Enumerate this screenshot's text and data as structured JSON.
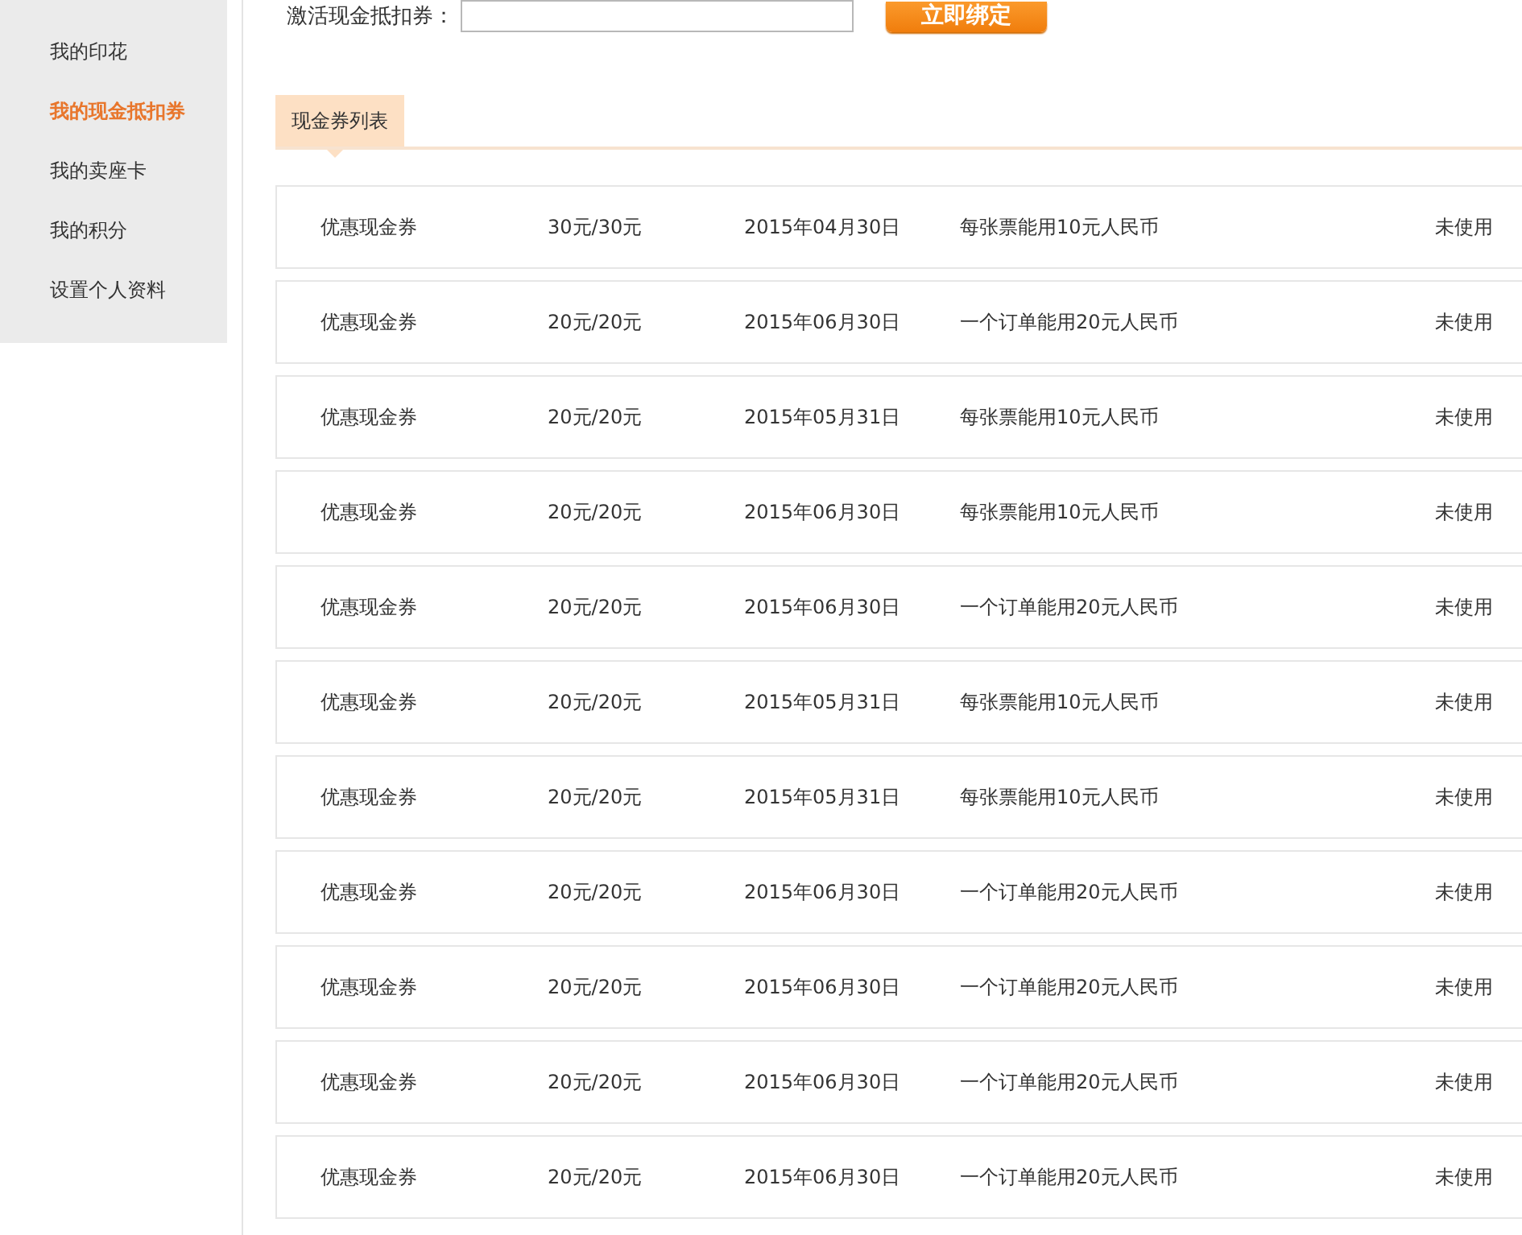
{
  "sidebar": {
    "items": [
      {
        "label": "我的印花",
        "selected": false
      },
      {
        "label": "我的现金抵扣券",
        "selected": true
      },
      {
        "label": "我的卖座卡",
        "selected": false
      },
      {
        "label": "我的积分",
        "selected": false
      },
      {
        "label": "设置个人资料",
        "selected": false
      }
    ]
  },
  "bind": {
    "label": "激活现金抵扣券：",
    "button": "立即绑定"
  },
  "tabs": [
    {
      "label": "现金券列表",
      "selected": true
    }
  ],
  "coupons": [
    {
      "name": "优惠现金券",
      "amount": "30元/30元",
      "expires": "2015年04月30日",
      "rule": "每张票能用10元人民币",
      "status": "未使用"
    },
    {
      "name": "优惠现金券",
      "amount": "20元/20元",
      "expires": "2015年06月30日",
      "rule": "一个订单能用20元人民币",
      "status": "未使用"
    },
    {
      "name": "优惠现金券",
      "amount": "20元/20元",
      "expires": "2015年05月31日",
      "rule": "每张票能用10元人民币",
      "status": "未使用"
    },
    {
      "name": "优惠现金券",
      "amount": "20元/20元",
      "expires": "2015年06月30日",
      "rule": "每张票能用10元人民币",
      "status": "未使用"
    },
    {
      "name": "优惠现金券",
      "amount": "20元/20元",
      "expires": "2015年06月30日",
      "rule": "一个订单能用20元人民币",
      "status": "未使用"
    },
    {
      "name": "优惠现金券",
      "amount": "20元/20元",
      "expires": "2015年05月31日",
      "rule": "每张票能用10元人民币",
      "status": "未使用"
    },
    {
      "name": "优惠现金券",
      "amount": "20元/20元",
      "expires": "2015年05月31日",
      "rule": "每张票能用10元人民币",
      "status": "未使用"
    },
    {
      "name": "优惠现金券",
      "amount": "20元/20元",
      "expires": "2015年06月30日",
      "rule": "一个订单能用20元人民币",
      "status": "未使用"
    },
    {
      "name": "优惠现金券",
      "amount": "20元/20元",
      "expires": "2015年06月30日",
      "rule": "一个订单能用20元人民币",
      "status": "未使用"
    },
    {
      "name": "优惠现金券",
      "amount": "20元/20元",
      "expires": "2015年06月30日",
      "rule": "一个订单能用20元人民币",
      "status": "未使用"
    },
    {
      "name": "优惠现金券",
      "amount": "20元/20元",
      "expires": "2015年06月30日",
      "rule": "一个订单能用20元人民币",
      "status": "未使用"
    }
  ]
}
